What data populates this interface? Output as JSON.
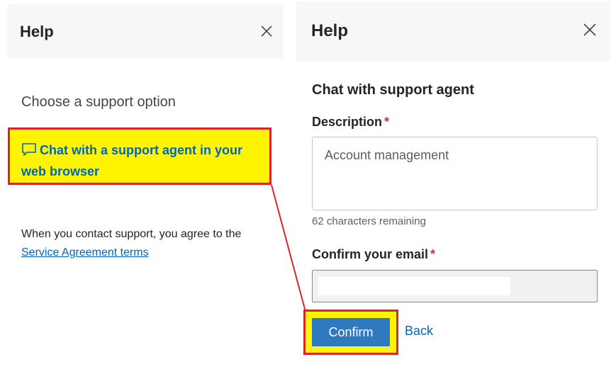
{
  "left_panel": {
    "title": "Help",
    "choose_text": "Choose a support option",
    "chat_link": "Chat with a support agent in your web browser",
    "agree_text": "When you contact support, you agree to the",
    "agree_link": "Service Agreement terms"
  },
  "right_panel": {
    "title": "Help",
    "section_title": "Chat with support agent",
    "description_label": "Description",
    "required_mark": "*",
    "description_value": "Account management",
    "remaining_text": "62 characters remaining",
    "email_label": "Confirm your email",
    "email_value": "",
    "confirm_label": "Confirm",
    "back_label": "Back"
  },
  "colors": {
    "highlight_fill": "#fff500",
    "highlight_border": "#d9262b",
    "link": "#0067b8",
    "button": "#2f79bf"
  },
  "icons": {
    "close": "close-icon",
    "chat": "chat-bubble-icon"
  }
}
